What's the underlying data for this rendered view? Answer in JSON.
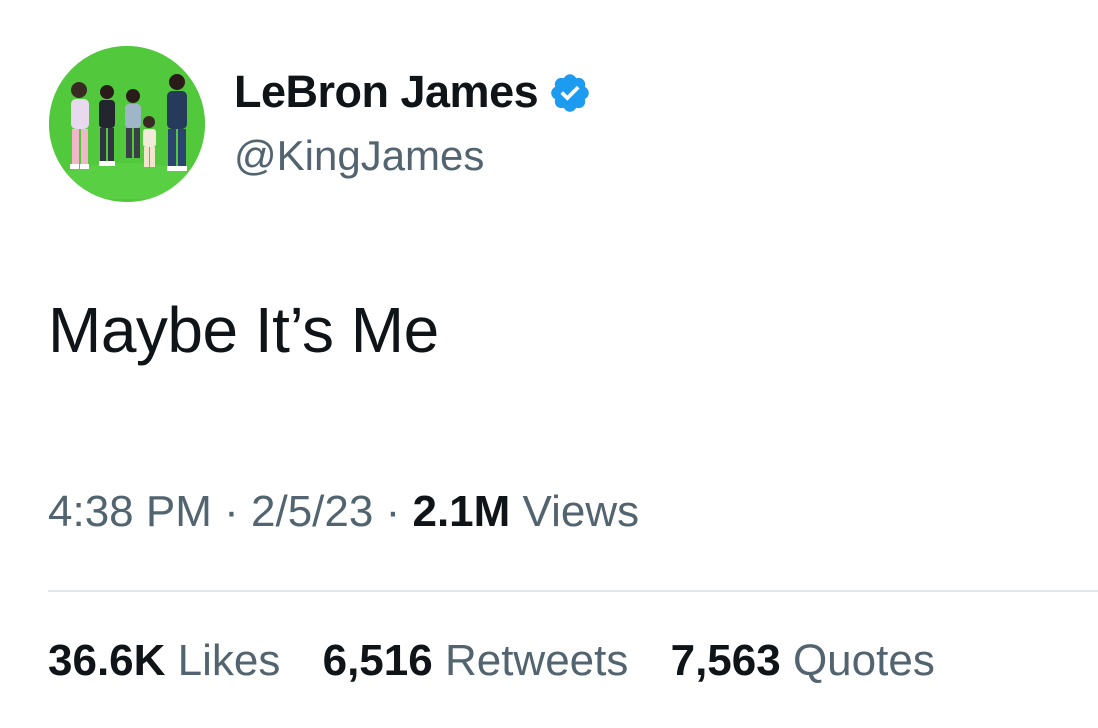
{
  "author": {
    "display_name": "LeBron James",
    "handle": "@KingJames",
    "verified": true,
    "verified_icon": "verified-badge-icon",
    "avatar": "profile photo: family posing on green backdrop"
  },
  "tweet": {
    "text": "Maybe It’s Me"
  },
  "meta": {
    "time": "4:38 PM",
    "date": "2/5/23",
    "separator": "·",
    "views_count": "2.1M",
    "views_label": "Views"
  },
  "stats": {
    "likes_count": "36.6K",
    "likes_label": "Likes",
    "retweets_count": "6,516",
    "retweets_label": "Retweets",
    "quotes_count": "7,563",
    "quotes_label": "Quotes"
  },
  "colors": {
    "verified_blue": "#1d9bf0",
    "secondary_text": "#536471",
    "primary_text": "#0f1419",
    "avatar_background": "#52c93c"
  }
}
